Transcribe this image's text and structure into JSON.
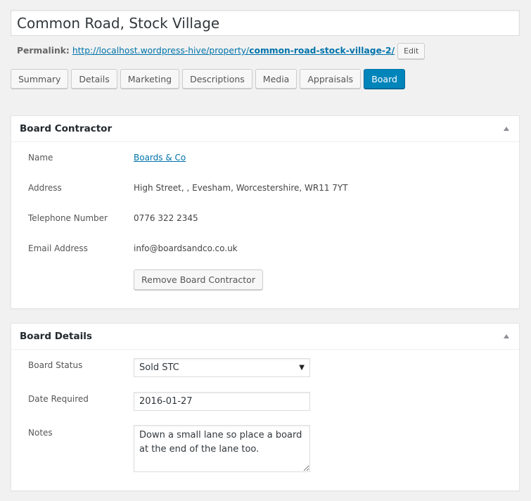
{
  "post": {
    "title": "Common Road, Stock Village",
    "permalink_label": "Permalink:",
    "permalink_base": "http://localhost.wordpress-hive/property/",
    "permalink_slug": "common-road-stock-village-2/",
    "edit_label": "Edit"
  },
  "tabs": [
    {
      "label": "Summary",
      "active": false
    },
    {
      "label": "Details",
      "active": false
    },
    {
      "label": "Marketing",
      "active": false
    },
    {
      "label": "Descriptions",
      "active": false
    },
    {
      "label": "Media",
      "active": false
    },
    {
      "label": "Appraisals",
      "active": false
    },
    {
      "label": "Board",
      "active": true
    }
  ],
  "board_contractor": {
    "title": "Board Contractor",
    "fields": [
      {
        "label": "Name",
        "value": "Boards & Co",
        "link": true
      },
      {
        "label": "Address",
        "value": "High Street, , Evesham, Worcestershire, WR11 7YT"
      },
      {
        "label": "Telephone Number",
        "value": "0776 322 2345"
      },
      {
        "label": "Email Address",
        "value": "info@boardsandco.co.uk"
      }
    ],
    "remove_label": "Remove Board Contractor"
  },
  "board_details": {
    "title": "Board Details",
    "status_label": "Board Status",
    "status_value": "Sold STC",
    "date_label": "Date Required",
    "date_value": "2016-01-27",
    "notes_label": "Notes",
    "notes_value": "Down a small lane so place a board at the end of the lane too."
  },
  "icons": {
    "toggle": "triangle-up",
    "select_arrow": "▼"
  },
  "colors": {
    "primary": "#0085ba",
    "link": "#0073aa",
    "background": "#f1f1f1"
  }
}
